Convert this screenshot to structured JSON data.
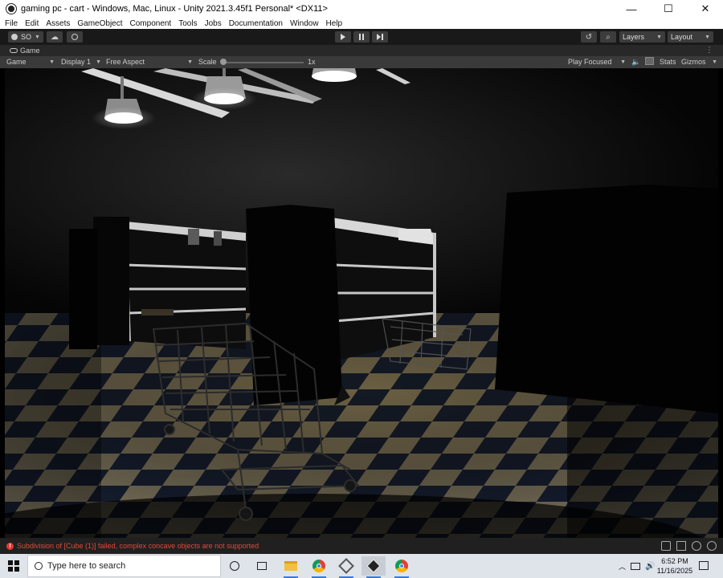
{
  "window": {
    "title": "gaming pc - cart - Windows, Mac, Linux - Unity 2021.3.45f1 Personal* <DX11>",
    "controls": {
      "minimize": "—",
      "maximize": "☐",
      "close": "✕"
    }
  },
  "menu": [
    "File",
    "Edit",
    "Assets",
    "GameObject",
    "Component",
    "Tools",
    "Jobs",
    "Documentation",
    "Window",
    "Help"
  ],
  "toolbar": {
    "account": "SO",
    "layers": "Layers",
    "layout": "Layout"
  },
  "game_tab": {
    "label": "Game"
  },
  "game_controls": {
    "view_select": "Game",
    "display_select": "Display 1",
    "aspect_select": "Free Aspect",
    "scale_label": "Scale",
    "scale_value": "1x",
    "scale_fraction": 0.0,
    "play_mode": "Play Focused",
    "stats_label": "Stats",
    "gizmos_label": "Gizmos"
  },
  "status": {
    "message": "Subdivision of [Cube (1)] failed, complex concave objects are not supported",
    "color": "#e04a3a"
  },
  "taskbar": {
    "search_placeholder": "Type here to search",
    "time": "6:52 PM",
    "date": "11/16/2025",
    "apps": [
      "cortana-icon",
      "task-view-icon",
      "file-explorer-icon",
      "chrome-icon",
      "unity-hub-icon",
      "unity-editor-icon",
      "chrome-icon"
    ]
  },
  "colors": {
    "accent": "#3b78d8",
    "editor_bg": "#282828",
    "error": "#e53935"
  }
}
